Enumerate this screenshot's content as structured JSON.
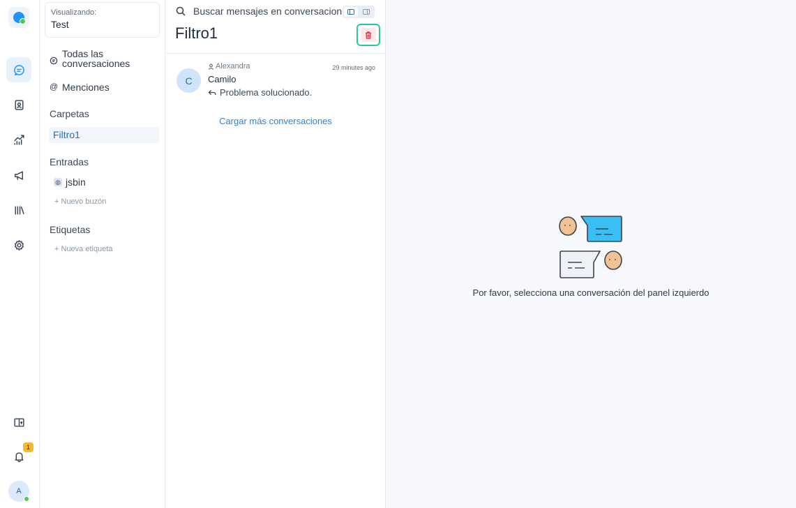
{
  "rail": {
    "nav": [
      {
        "name": "conversations-icon",
        "active": true
      },
      {
        "name": "contacts-icon",
        "active": false
      },
      {
        "name": "reports-icon",
        "active": false
      },
      {
        "name": "campaigns-icon",
        "active": false
      },
      {
        "name": "library-icon",
        "active": false
      },
      {
        "name": "settings-icon",
        "active": false
      }
    ],
    "notification_count": "1",
    "avatar_initial": "A",
    "accent": "#1f93ff",
    "online_color": "#44ce4b"
  },
  "sidebar": {
    "account_label": "Visualizando:",
    "account_name": "Test",
    "all_conversations": "Todas las conversaciones",
    "mentions": "Menciones",
    "folders_heading": "Carpetas",
    "folder_active": "Filtro1",
    "inboxes_heading": "Entradas",
    "inbox_name": "jsbin",
    "new_inbox": "Nuevo buzón",
    "labels_heading": "Etiquetas",
    "new_label": "Nueva etiqueta"
  },
  "list": {
    "search_placeholder": "Buscar mensajes en conversaciones",
    "folder_title": "Filtro1",
    "conversations": [
      {
        "initial": "C",
        "assignee": "Alexandra",
        "time": "29 minutes ago",
        "name": "Camilo",
        "last_message": "Problema solucionado."
      }
    ],
    "load_more": "Cargar más conversaciones"
  },
  "main": {
    "empty_text": "Por favor, selecciona una conversación del panel izquierdo"
  }
}
